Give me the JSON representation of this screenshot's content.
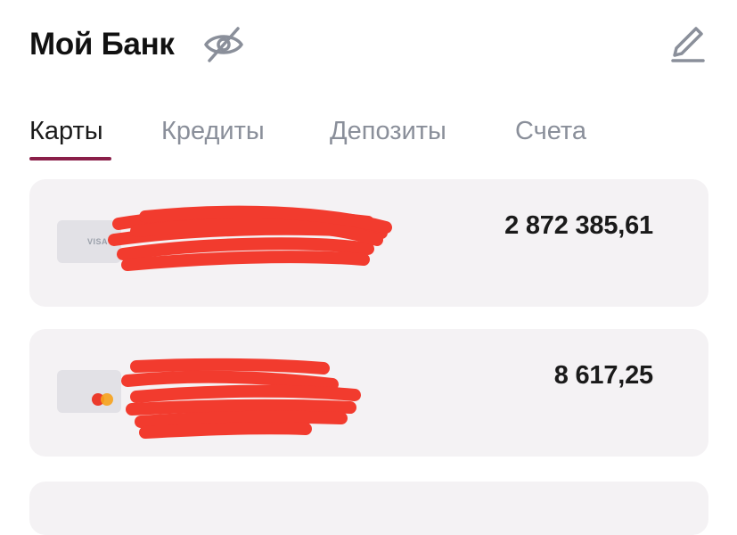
{
  "header": {
    "title": "Мой Банк"
  },
  "tabs": [
    {
      "label": "Карты",
      "active": true
    },
    {
      "label": "Кредиты",
      "active": false
    },
    {
      "label": "Депозиты",
      "active": false
    },
    {
      "label": "Счета",
      "active": false
    }
  ],
  "cards": [
    {
      "amount": "2 872 385,61",
      "network_icon": "visa-icon",
      "network_text": "VISA"
    },
    {
      "amount": "8 617,25",
      "network_icon": "mastercard-icon"
    }
  ],
  "colors": {
    "tab_accent": "#8a1f49",
    "card_bg": "#f4f2f4",
    "redaction": "#f23b2e"
  }
}
